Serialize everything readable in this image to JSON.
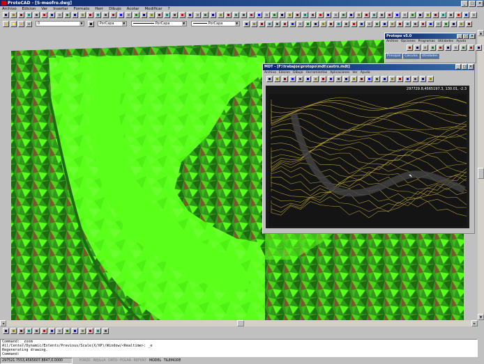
{
  "app": {
    "title": "ProtoCAD - [S-meofro.dwg]",
    "menu": [
      "Archivo",
      "Edicion",
      "Ver",
      "Insertar",
      "Formato",
      "Herr",
      "Dibujo",
      "Acotar",
      "Modificar",
      "?"
    ],
    "layer_combo": "0",
    "color_combo": "PorCapa",
    "linetype_combo": "PorCapa",
    "lineweight_combo": "PorCapa"
  },
  "protopo": {
    "title": "Protopo v5.0",
    "menu": [
      "Archivo",
      "Opciones",
      "Programas",
      "Utilidades",
      "Ayuda"
    ],
    "tabs": [
      "Principal",
      "Calculos",
      "Utilidades"
    ]
  },
  "mdt": {
    "title": "MDT - [F:\\trabajos\\protopo\\mdt\\castro.mdt]",
    "menu": [
      "Archivo",
      "Edicion",
      "Dibujo",
      "Herramientas",
      "Aplicaciones",
      "Ver",
      "Ayuda"
    ],
    "coords": "297729.8,4565197.3, 130.01, -2.3"
  },
  "command": {
    "lines": [
      "Command: _zoom",
      "All/Center/Dynamic/Extents/Previous/Scale(X/XP)/Window/<Realtime>: _e",
      "Regenerating drawing.",
      "Command:"
    ]
  },
  "status": {
    "coords": "297521.7553,4565607.8847,0.0000",
    "modes": [
      "FORZC",
      "REJILLA",
      "ORTO",
      "POLAR",
      "REFENT",
      "MODEL",
      "TILEMODE"
    ]
  },
  "colors": {
    "terrain_bright": "#5aff1a",
    "terrain_dark": "#1e6b12",
    "mdt_background": "#1a1a1a",
    "contour": "#b09a30",
    "titlebar": "#0a246a"
  }
}
